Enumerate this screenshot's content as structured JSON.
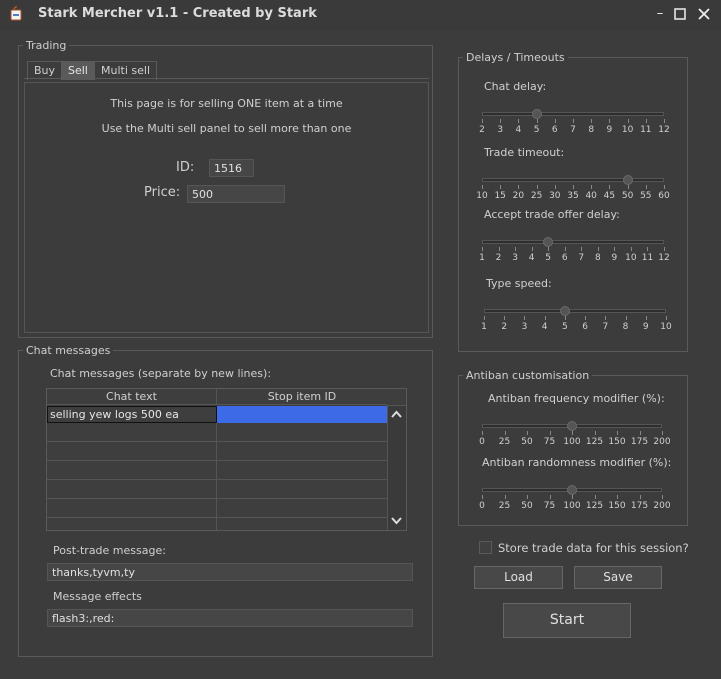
{
  "window": {
    "title": "Stark Mercher v1.1 - Created by Stark",
    "minimize": "–",
    "maximize": "☐",
    "close": "✕"
  },
  "trading": {
    "title": "Trading",
    "tabs": [
      {
        "label": "Buy"
      },
      {
        "label": "Sell"
      },
      {
        "label": "Multi sell"
      }
    ],
    "active_tab": "Sell",
    "info_line1": "This page is for selling ONE item at a time",
    "info_line2": "Use the Multi sell panel to sell more than one",
    "id_label": "ID:",
    "id_value": "1516",
    "price_label": "Price:",
    "price_value": "500"
  },
  "chat": {
    "title": "Chat messages",
    "subtitle": "Chat messages (separate by new lines):",
    "columns": [
      "Chat text",
      "Stop item ID"
    ],
    "rows": [
      [
        "selling yew logs 500 ea",
        ""
      ]
    ],
    "post_trade_label": "Post-trade message:",
    "post_trade_value": "thanks,tyvm,ty",
    "effects_label": "Message effects",
    "effects_value": "flash3:,red:"
  },
  "delays": {
    "title": "Delays / Timeouts",
    "sliders": [
      {
        "label": "Chat delay:",
        "ticks": [
          "2",
          "3",
          "4",
          "5",
          "6",
          "7",
          "8",
          "9",
          "10",
          "11",
          "12"
        ],
        "value": 5
      },
      {
        "label": "Trade timeout:",
        "ticks": [
          "10",
          "15",
          "20",
          "25",
          "30",
          "35",
          "40",
          "45",
          "50",
          "55",
          "60"
        ],
        "value": 50
      },
      {
        "label": "Accept trade offer delay:",
        "ticks": [
          "1",
          "2",
          "3",
          "4",
          "5",
          "6",
          "7",
          "8",
          "9",
          "10",
          "11",
          "12"
        ],
        "value": 5
      },
      {
        "label": "Type speed:",
        "ticks": [
          "1",
          "2",
          "3",
          "4",
          "5",
          "6",
          "7",
          "8",
          "9",
          "10"
        ],
        "value": 5
      }
    ]
  },
  "antiban": {
    "title": "Antiban customisation",
    "sliders": [
      {
        "label": "Antiban frequency modifier (%):",
        "ticks": [
          "0",
          "25",
          "50",
          "75",
          "100",
          "125",
          "150",
          "175",
          "200"
        ],
        "value": 100
      },
      {
        "label": "Antiban randomness modifier (%):",
        "ticks": [
          "0",
          "25",
          "50",
          "75",
          "100",
          "125",
          "150",
          "175",
          "200"
        ],
        "value": 100
      }
    ]
  },
  "store_label": "Store trade data for this session?",
  "store_checked": false,
  "load_label": "Load",
  "save_label": "Save",
  "start_label": "Start",
  "colors": {
    "selection": "#3d6be8",
    "background": "#3c3c3c"
  }
}
